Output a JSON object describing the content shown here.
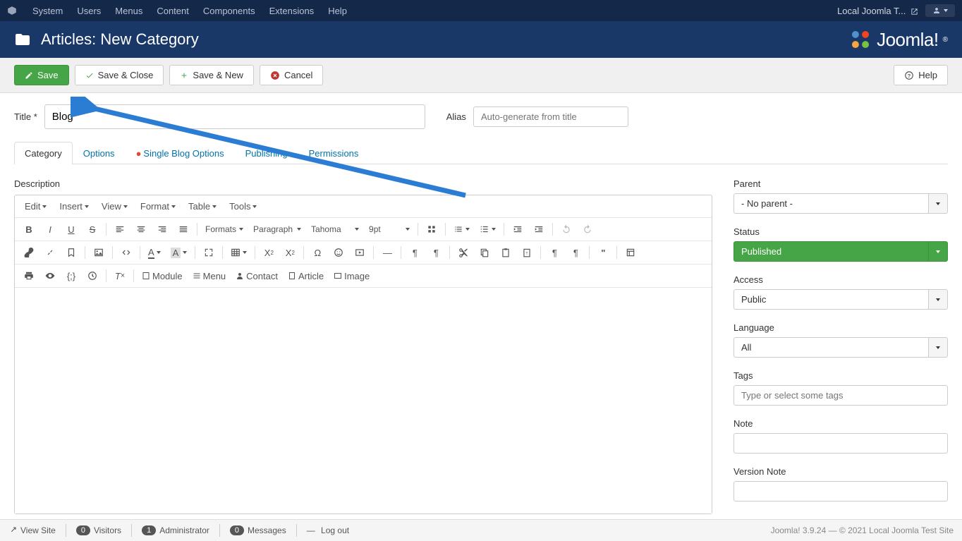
{
  "topbar": {
    "menus": [
      "System",
      "Users",
      "Menus",
      "Content",
      "Components",
      "Extensions",
      "Help"
    ],
    "site_name": "Local Joomla T..."
  },
  "header": {
    "title": "Articles: New Category",
    "brand": "Joomla!"
  },
  "toolbar": {
    "save": "Save",
    "save_close": "Save & Close",
    "save_new": "Save & New",
    "cancel": "Cancel",
    "help": "Help"
  },
  "fields": {
    "title_label": "Title *",
    "title_value": "Blog",
    "alias_label": "Alias",
    "alias_placeholder": "Auto-generate from title"
  },
  "tabs": {
    "category": "Category",
    "options": "Options",
    "single_blog": "Single Blog Options",
    "publishing": "Publishing",
    "permissions": "Permissions"
  },
  "editor": {
    "description_label": "Description",
    "menus": [
      "Edit",
      "Insert",
      "View",
      "Format",
      "Table",
      "Tools"
    ],
    "formats": "Formats",
    "paragraph": "Paragraph",
    "font": "Tahoma",
    "size": "9pt",
    "module_btn": "Module",
    "menu_btn": "Menu",
    "contact_btn": "Contact",
    "article_btn": "Article",
    "image_btn": "Image"
  },
  "sidebar": {
    "parent": {
      "label": "Parent",
      "value": "- No parent -"
    },
    "status": {
      "label": "Status",
      "value": "Published"
    },
    "access": {
      "label": "Access",
      "value": "Public"
    },
    "language": {
      "label": "Language",
      "value": "All"
    },
    "tags": {
      "label": "Tags",
      "placeholder": "Type or select some tags"
    },
    "note": {
      "label": "Note"
    },
    "version_note": {
      "label": "Version Note"
    }
  },
  "statusbar": {
    "view_site": "View Site",
    "visitors_count": "0",
    "visitors": "Visitors",
    "admin_count": "1",
    "admin": "Administrator",
    "messages_count": "0",
    "messages": "Messages",
    "logout": "Log out",
    "footer": "Joomla! 3.9.24  —  © 2021 Local Joomla Test Site"
  }
}
